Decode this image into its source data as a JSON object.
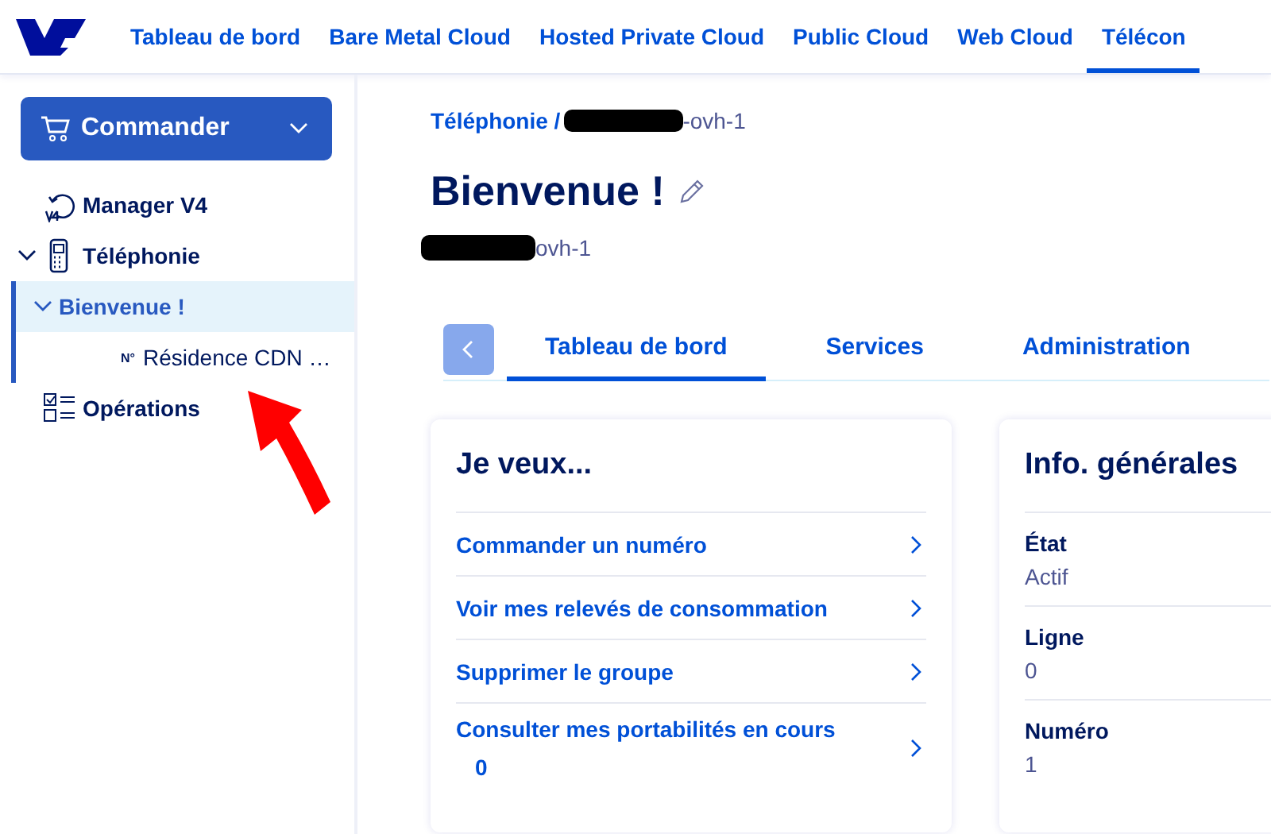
{
  "top_nav": [
    {
      "label": "Tableau de bord",
      "selected": false
    },
    {
      "label": "Bare Metal Cloud",
      "selected": false
    },
    {
      "label": "Hosted Private Cloud",
      "selected": false
    },
    {
      "label": "Public Cloud",
      "selected": false
    },
    {
      "label": "Web Cloud",
      "selected": false
    },
    {
      "label": "Télécon",
      "selected": true
    }
  ],
  "sidebar": {
    "order_button": "Commander",
    "tree": [
      {
        "label": "Manager V4",
        "kind": "v4",
        "selected": false
      },
      {
        "label": "Téléphonie",
        "kind": "phone",
        "selected": false,
        "expanded": true,
        "children": [
          {
            "label": "Bienvenue !",
            "selected": true,
            "expanded": true,
            "children": [
              {
                "label": "Résidence CDN …",
                "kind": "number",
                "prefix": "N°",
                "selected": false
              }
            ]
          }
        ]
      },
      {
        "label": "Opérations",
        "kind": "tasks",
        "selected": false
      }
    ]
  },
  "main": {
    "breadcrumb": {
      "link": "Téléphonie /",
      "rest": "-ovh-1"
    },
    "title": "Bienvenue !",
    "subtitle": "ovh-1",
    "tabs": [
      {
        "label": "Tableau de bord",
        "selected": true
      },
      {
        "label": "Services",
        "selected": false
      },
      {
        "label": "Administration",
        "selected": false
      }
    ],
    "actions": {
      "title": "Je veux...",
      "items": [
        {
          "label": "Commander un numéro"
        },
        {
          "label": "Voir mes relevés de consommation"
        },
        {
          "label": "Supprimer le groupe"
        },
        {
          "label": "Consulter mes portabilités en cours",
          "count": "0"
        }
      ]
    },
    "info": {
      "title": "Info. générales",
      "fields": [
        {
          "label": "État",
          "value": "Actif"
        },
        {
          "label": "Ligne",
          "value": "0"
        },
        {
          "label": "Numéro",
          "value": "1"
        }
      ]
    }
  }
}
